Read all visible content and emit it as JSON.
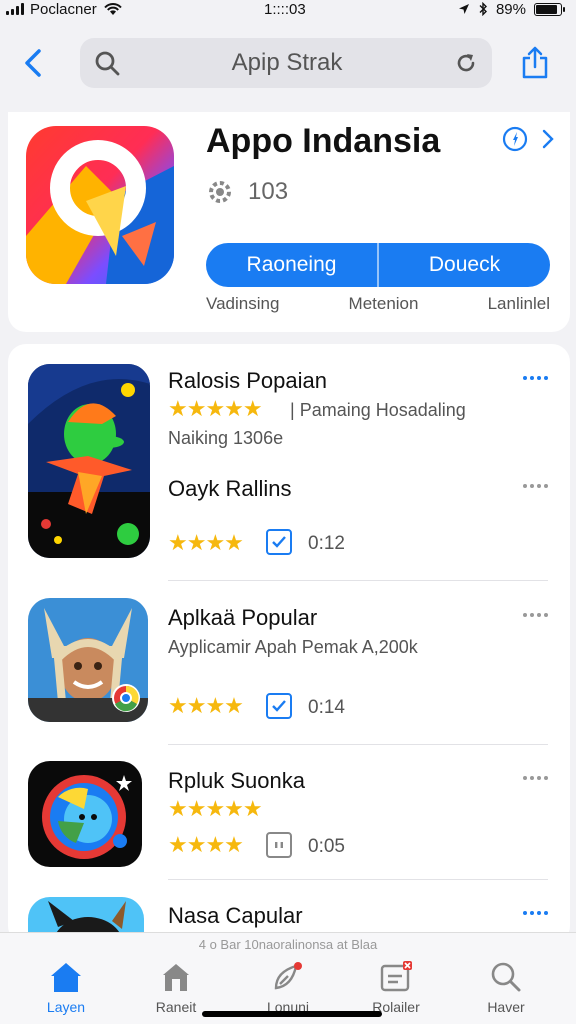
{
  "status_bar": {
    "carrier": "Poclacner",
    "time": "1::::03",
    "battery": "89%",
    "battery_level": 0.89
  },
  "nav": {
    "search_text": "Apip Strak"
  },
  "hero": {
    "title": "Appo Indansia",
    "meta_value": "103",
    "button_left": "Raoneing",
    "button_right": "Doueck",
    "labels": [
      "Vadinsing",
      "Metenion",
      "Lanlinlel"
    ]
  },
  "apps": [
    {
      "title": "Ralosis Popaian",
      "rating_text": "Pamaing Hosadaling",
      "sub": "Naiking 1306e",
      "title2": "Oayk Rallins",
      "duration": "0:12",
      "stars": "★★★★",
      "top_stars": "★★★★★"
    },
    {
      "title": "Aplkaä Popular",
      "sub": "Ayplicamir Apah Pemak A,200k",
      "duration": "0:14",
      "stars": "★★★★"
    },
    {
      "title": "Rpluk Suonka",
      "duration": "0:05",
      "stars": "★★★★",
      "top_stars": "★★★★★"
    },
    {
      "title": "Nasa Capular"
    }
  ],
  "tab_bar": {
    "caption": "4 o Bar 10naoralinonsa at Blaa",
    "tabs": [
      {
        "label": "Layen"
      },
      {
        "label": "Raneit"
      },
      {
        "label": "Lonuni"
      },
      {
        "label": "Rolailer"
      },
      {
        "label": "Haver"
      }
    ]
  },
  "colors": {
    "accent": "#1a7cf2",
    "star": "#f6b80e",
    "background": "#f2f2f5"
  }
}
